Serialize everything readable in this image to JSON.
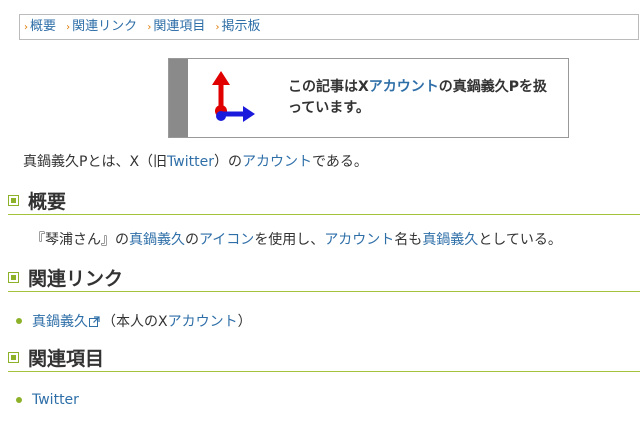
{
  "breadcrumb": [
    {
      "label": "概要"
    },
    {
      "label": "関連リンク"
    },
    {
      "label": "関連項目"
    },
    {
      "label": "掲示板"
    }
  ],
  "notice": {
    "icon": "x-axis-arrows-icon",
    "part1": "この記事は",
    "part2": "X",
    "link": "アカウント",
    "part3": "の真鍋義久Pを扱っています。"
  },
  "intro": {
    "t1": "真鍋義久Pとは、X（旧",
    "link1": "Twitter",
    "t2": "）の",
    "link2": "アカウント",
    "t3": "である。"
  },
  "sections": {
    "overview": {
      "title": "概要",
      "t1": "『琴浦さん』の",
      "link1": "真鍋義久",
      "t2": "の",
      "link2": "アイコン",
      "t3": "を使用し、",
      "link3": "アカウント",
      "t4": "名も",
      "link4": "真鍋義久",
      "t5": "としている。"
    },
    "related_links": {
      "title": "関連リンク",
      "item_link": "真鍋義久",
      "item_t1": "（本人のX",
      "item_link2": "アカウント",
      "item_t2": "）"
    },
    "related_items": {
      "title": "関連項目",
      "item_link": "Twitter"
    }
  },
  "colors": {
    "link": "#2f6fa8",
    "accent": "#8db22a",
    "bar": "#8a8a8a"
  }
}
